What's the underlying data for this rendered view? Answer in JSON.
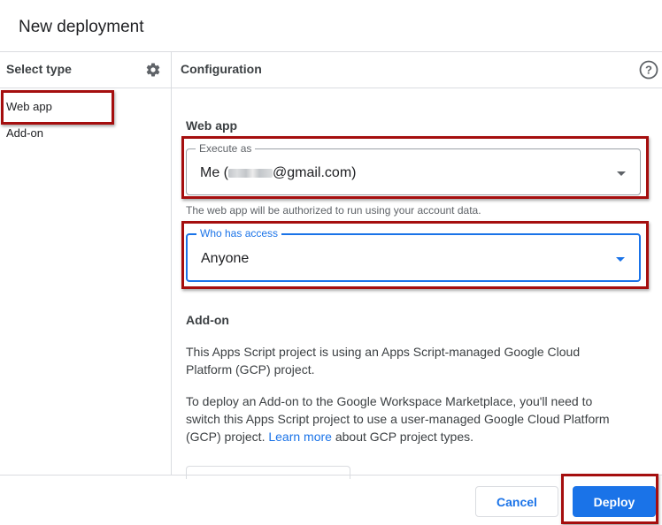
{
  "dialog": {
    "title": "New deployment"
  },
  "left_panel": {
    "header": "Select type",
    "settings_icon": "gear-icon",
    "types": [
      {
        "label": "Web app",
        "selected": true
      },
      {
        "label": "Add-on",
        "selected": false
      }
    ]
  },
  "right_panel": {
    "header": "Configuration",
    "help_icon": "help-circle-icon",
    "web_app": {
      "section_title": "Web app",
      "execute_as": {
        "label": "Execute as",
        "value_prefix": "Me (",
        "value_suffix": "@gmail.com)"
      },
      "hint": "The web app will be authorized to run using your account data.",
      "who_has_access": {
        "label": "Who has access",
        "value": "Anyone"
      }
    },
    "add_on": {
      "section_title": "Add-on",
      "paragraph1": "This Apps Script project is using an Apps Script-managed Google Cloud Platform (GCP) project.",
      "paragraph2_before": "To deploy an Add-on to the Google Workspace Marketplace, you'll need to switch this Apps Script project to use a user-managed Google Cloud Platform (GCP) project. ",
      "paragraph2_link": "Learn more",
      "paragraph2_after": " about GCP project types."
    }
  },
  "footer": {
    "cancel_label": "Cancel",
    "deploy_label": "Deploy"
  },
  "colors": {
    "accent": "#1a73e8",
    "highlight_box": "#a50e0e"
  }
}
